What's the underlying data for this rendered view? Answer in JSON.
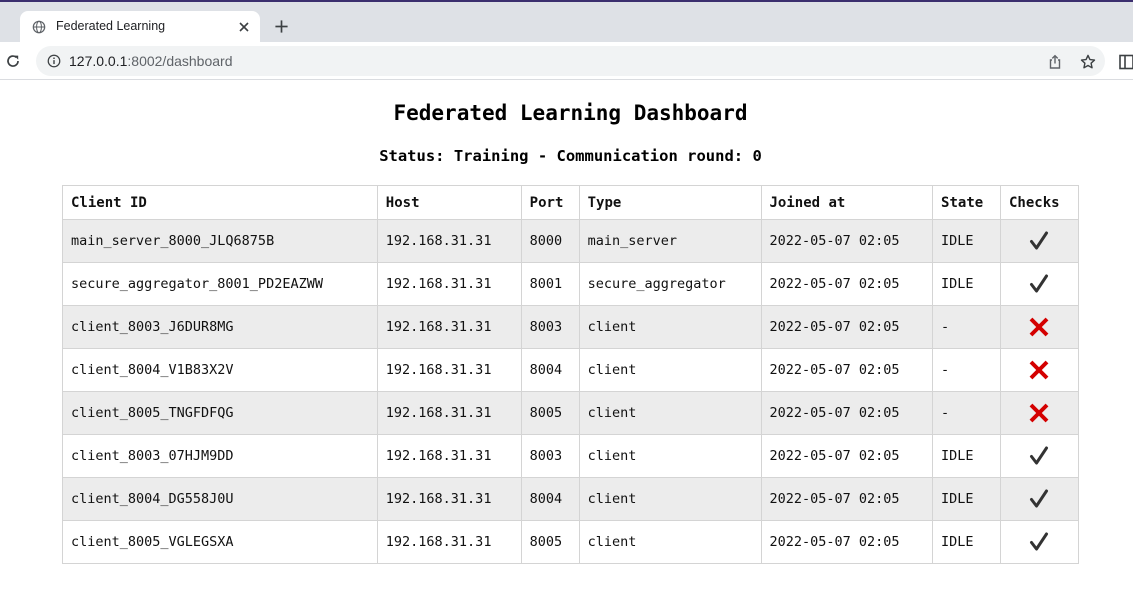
{
  "browser": {
    "tab_title": "Federated Learning",
    "url_host": "127.0.0.1",
    "url_path": ":8002/dashboard",
    "icons": [
      "globe-icon",
      "close-icon",
      "plus-icon",
      "reload-icon",
      "info-icon",
      "share-icon",
      "star-icon",
      "side-panel-icon"
    ]
  },
  "dashboard": {
    "title": "Federated Learning Dashboard",
    "status": "Status: Training - Communication round: 0",
    "columns": [
      "Client ID",
      "Host",
      "Port",
      "Type",
      "Joined at",
      "State",
      "Checks"
    ],
    "rows": [
      {
        "client_id": "main_server_8000_JLQ6875B",
        "host": "192.168.31.31",
        "port": "8000",
        "type": "main_server",
        "joined_at": "2022-05-07 02:05",
        "state": "IDLE",
        "check": "pass"
      },
      {
        "client_id": "secure_aggregator_8001_PD2EAZWW",
        "host": "192.168.31.31",
        "port": "8001",
        "type": "secure_aggregator",
        "joined_at": "2022-05-07 02:05",
        "state": "IDLE",
        "check": "pass"
      },
      {
        "client_id": "client_8003_J6DUR8MG",
        "host": "192.168.31.31",
        "port": "8003",
        "type": "client",
        "joined_at": "2022-05-07 02:05",
        "state": "-",
        "check": "fail"
      },
      {
        "client_id": "client_8004_V1B83X2V",
        "host": "192.168.31.31",
        "port": "8004",
        "type": "client",
        "joined_at": "2022-05-07 02:05",
        "state": "-",
        "check": "fail"
      },
      {
        "client_id": "client_8005_TNGFDFQG",
        "host": "192.168.31.31",
        "port": "8005",
        "type": "client",
        "joined_at": "2022-05-07 02:05",
        "state": "-",
        "check": "fail"
      },
      {
        "client_id": "client_8003_07HJM9DD",
        "host": "192.168.31.31",
        "port": "8003",
        "type": "client",
        "joined_at": "2022-05-07 02:05",
        "state": "IDLE",
        "check": "pass"
      },
      {
        "client_id": "client_8004_DG558J0U",
        "host": "192.168.31.31",
        "port": "8004",
        "type": "client",
        "joined_at": "2022-05-07 02:05",
        "state": "IDLE",
        "check": "pass"
      },
      {
        "client_id": "client_8005_VGLEGSXA",
        "host": "192.168.31.31",
        "port": "8005",
        "type": "client",
        "joined_at": "2022-05-07 02:05",
        "state": "IDLE",
        "check": "pass"
      }
    ]
  },
  "colors": {
    "check_pass": "#333333",
    "check_fail": "#d40000",
    "row_alt": "#ececec"
  }
}
